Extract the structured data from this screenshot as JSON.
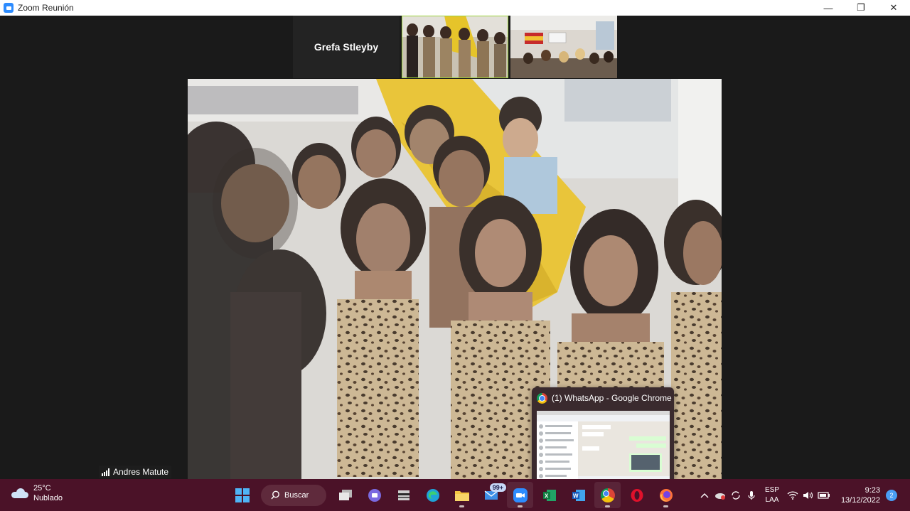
{
  "window": {
    "title": "Zoom Reunión",
    "minimize_label": "—",
    "restore_label": "❐",
    "close_label": "✕"
  },
  "meeting": {
    "gallery": {
      "name_tile_label": "Grefa Stleyby"
    },
    "active_speaker": "Andres Matute"
  },
  "preview": {
    "title": "(1) WhatsApp - Google Chrome"
  },
  "taskbar": {
    "weather": {
      "temperature": "25°C",
      "condition": "Nublado"
    },
    "search_label": "Buscar",
    "mail_badge": "99+",
    "language": {
      "code": "ESP",
      "layout": "LAA"
    },
    "clock": {
      "time": "9:23",
      "date": "13/12/2022"
    },
    "notification_count": "2",
    "accent": "#4b1228"
  }
}
